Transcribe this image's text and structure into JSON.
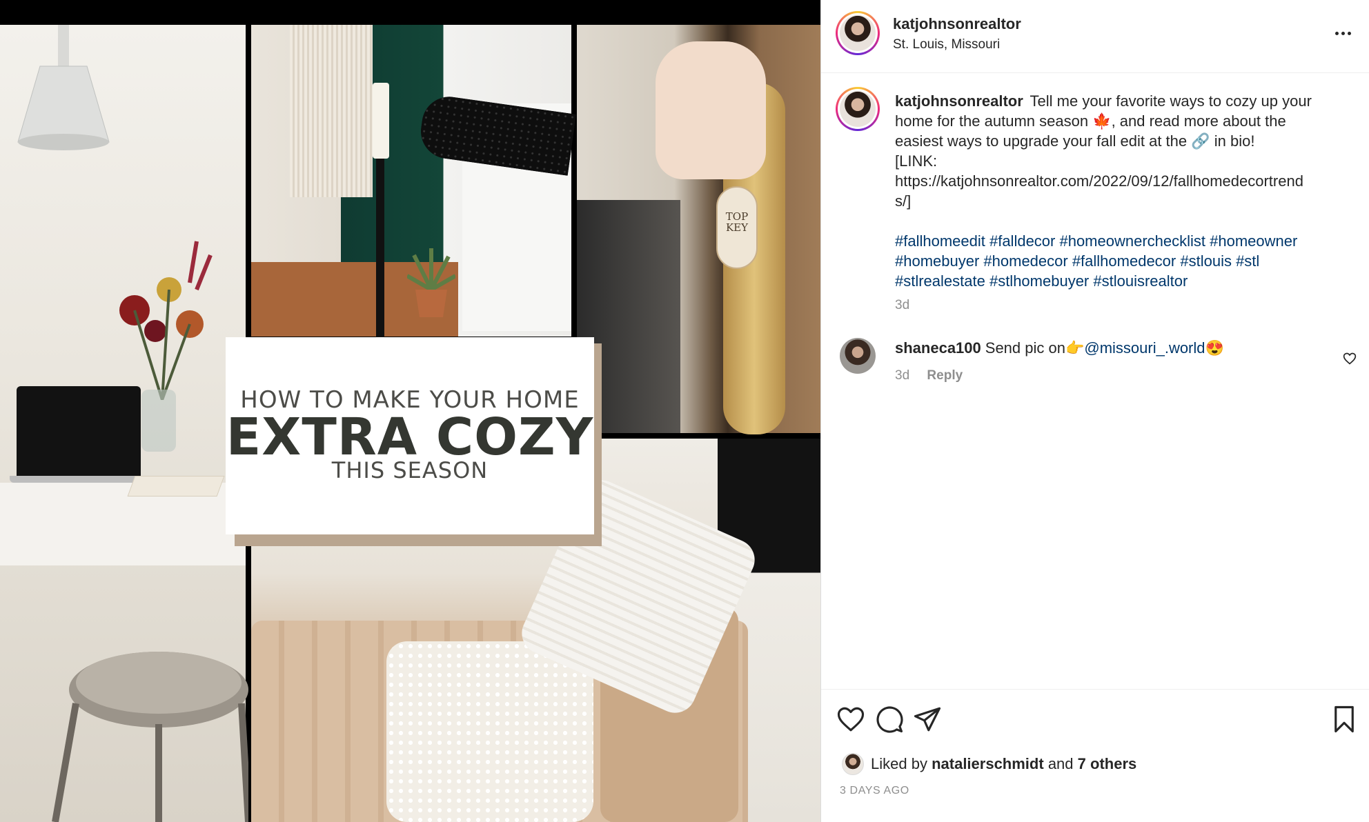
{
  "post_image": {
    "title_line1": "HOW TO MAKE YOUR HOME",
    "title_line2": "EXTRA COZY",
    "title_line3": "THIS SEASON",
    "key_tag_text": "TOP KEY"
  },
  "header": {
    "username": "katjohnsonrealtor",
    "location": "St. Louis, Missouri",
    "more_icon": "more-horizontal-icon"
  },
  "caption": {
    "username": "katjohnsonrealtor",
    "line1": "Tell me your favorite ways to cozy up your",
    "line2": "home for the autumn season 🍁, and read more about the",
    "line3": "easiest ways to upgrade your fall edit at the 🔗 in bio!",
    "line4": "[LINK:",
    "line5": "https://katjohnsonrealtor.com/2022/09/12/fallhomedecortrend",
    "line6": "s/]",
    "hashtags_line1": "#fallhomeedit #falldecor #homeownerchecklist #homeowner",
    "hashtags_line2": "#homebuyer #homedecor #fallhomedecor #stlouis #stl",
    "hashtags_line3": "#stlrealestate #stlhomebuyer #stlouisrealtor",
    "time": "3d"
  },
  "comments": [
    {
      "username": "shaneca100",
      "text_prefix": "Send pic on👉",
      "mention": "@missouri_.world",
      "text_suffix": "😍",
      "time": "3d",
      "reply_label": "Reply"
    }
  ],
  "actions": {
    "like_icon": "heart-icon",
    "comment_icon": "comment-icon",
    "share_icon": "paper-plane-icon",
    "save_icon": "bookmark-icon"
  },
  "likes": {
    "prefix": "Liked by",
    "user": "natalierschmidt",
    "middle": "and",
    "others": "7 others"
  },
  "post_date": "3 DAYS AGO",
  "colors": {
    "link": "#00376b",
    "muted": "#8e8e8e",
    "text": "#262626",
    "border": "#dbdbdb"
  }
}
